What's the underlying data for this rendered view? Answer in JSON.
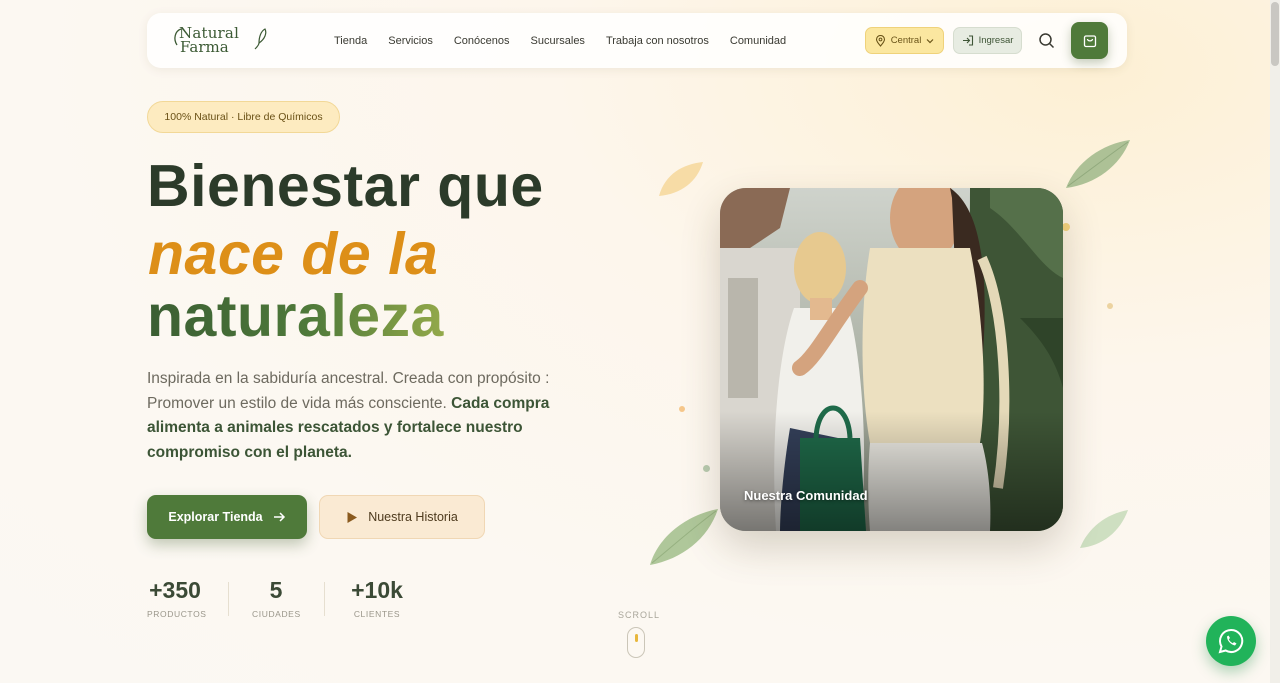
{
  "brand": {
    "line1": "Natural",
    "line2": "Farma"
  },
  "nav": {
    "links": [
      "Tienda",
      "Servicios",
      "Conócenos",
      "Sucursales",
      "Trabaja con nosotros",
      "Comunidad"
    ],
    "location_label": "Central",
    "login_label": "Ingresar"
  },
  "hero": {
    "badge": "100% Natural · Libre de Químicos",
    "title_line1": "Bienestar que",
    "title_line2": "nace de la",
    "title_line3": "naturaleza",
    "description_plain": "Inspirada en la sabiduría ancestral. Creada con propósito : Promover un estilo de vida más consciente.",
    "description_bold": "Cada compra alimenta a animales rescatados y fortalece nuestro compromiso con el planeta.",
    "primary_button": "Explorar Tienda",
    "secondary_button": "Nuestra Historia",
    "image_caption": "Nuestra Comunidad"
  },
  "stats": [
    {
      "value": "+350",
      "label": "PRODUCTOS"
    },
    {
      "value": "5",
      "label": "CIUDADES"
    },
    {
      "value": "+10k",
      "label": "CLIENTES"
    }
  ],
  "scroll_label": "SCROLL",
  "colors": {
    "brand_green": "#4f7a3a",
    "accent_orange": "#dd8f18",
    "heading_dark": "#2c3b2a",
    "whatsapp": "#21b35a"
  }
}
